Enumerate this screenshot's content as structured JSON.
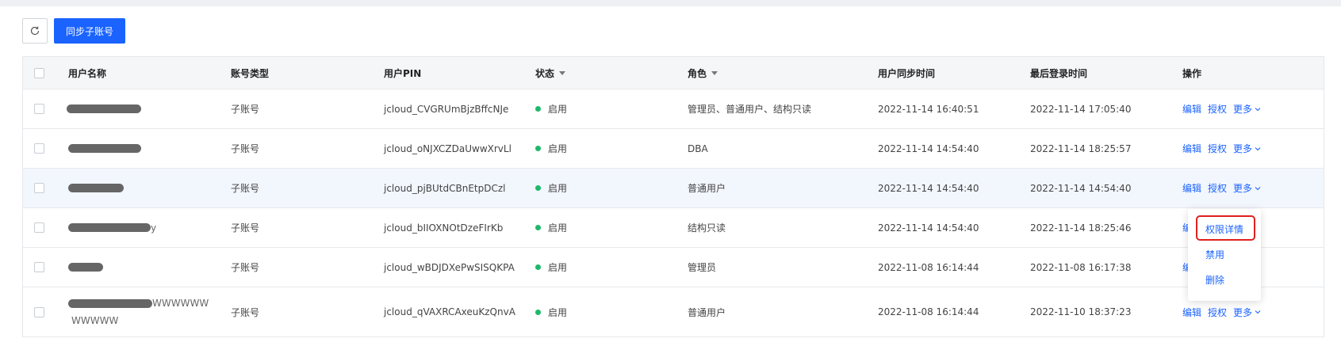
{
  "toolbar": {
    "sync_label": "同步子账号",
    "refresh_icon": "refresh-icon"
  },
  "columns": {
    "username": "用户名称",
    "account_type": "账号类型",
    "pin": "用户PIN",
    "status": "状态",
    "role": "角色",
    "sync_time": "用户同步时间",
    "last_login": "最后登录时间",
    "actions": "操作"
  },
  "rows": [
    {
      "name_suffix": "",
      "type": "子账号",
      "pin": "jcloud_CVGRUmBjzBffcNJe",
      "status": "启用",
      "role": "管理员、普通用户、结构只读",
      "sync": "2022-11-14 16:40:51",
      "login": "2022-11-14 17:05:40"
    },
    {
      "name_suffix": "",
      "type": "子账号",
      "pin": "jcloud_oNJXCZDaUwwXrvLl",
      "status": "启用",
      "role": "DBA",
      "sync": "2022-11-14 14:54:40",
      "login": "2022-11-14 18:25:57"
    },
    {
      "name_suffix": "",
      "type": "子账号",
      "pin": "jcloud_pjBUtdCBnEtpDCzl",
      "status": "启用",
      "role": "普通用户",
      "sync": "2022-11-14 14:54:40",
      "login": "2022-11-14 14:54:40"
    },
    {
      "name_suffix": "y",
      "type": "子账号",
      "pin": "jcloud_bIIOXNOtDzeFIrKb",
      "status": "启用",
      "role": "结构只读",
      "sync": "2022-11-14 14:54:40",
      "login": "2022-11-14 18:25:46"
    },
    {
      "name_suffix": "",
      "type": "子账号",
      "pin": "jcloud_wBDJDXePwSISQKPA",
      "status": "启用",
      "role": "管理员",
      "sync": "2022-11-08 16:14:44",
      "login": "2022-11-08 16:17:38"
    },
    {
      "name_suffix": "WWWWWW",
      "name_line2": "WWWWW",
      "type": "子账号",
      "pin": "jcloud_qVAXRCAxeuKzQnvA",
      "status": "启用",
      "role": "普通用户",
      "sync": "2022-11-08 16:14:44",
      "login": "2022-11-10 18:37:23"
    }
  ],
  "actions": {
    "edit": "编辑",
    "grant": "授权",
    "more": "更多",
    "edit_cut": "编"
  },
  "dropdown": {
    "detail": "权限详情",
    "disable": "禁用",
    "delete": "删除"
  },
  "colors": {
    "primary": "#1a63ff",
    "enabled": "#1db96a",
    "highlight": "#e02020"
  }
}
